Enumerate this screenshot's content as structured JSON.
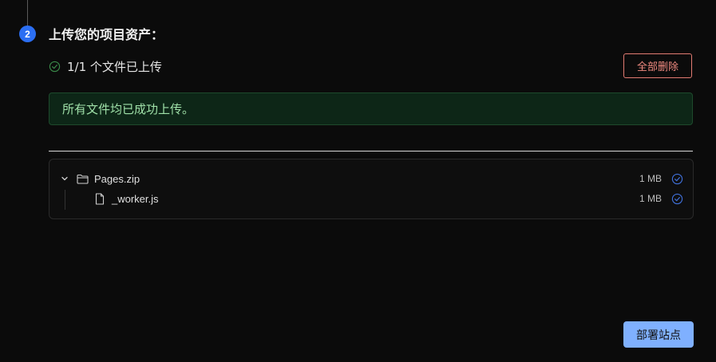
{
  "step": {
    "number": "2",
    "title": "上传您的项目资产："
  },
  "status": {
    "text": "1/1 个文件已上传"
  },
  "actions": {
    "delete_all_label": "全部删除",
    "deploy_label": "部署站点"
  },
  "banner": {
    "text": "所有文件均已成功上传。"
  },
  "files": [
    {
      "name": "Pages.zip",
      "size": "1 MB",
      "type": "folder",
      "expanded": true
    },
    {
      "name": "_worker.js",
      "size": "1 MB",
      "type": "file"
    }
  ],
  "colors": {
    "accent": "#2b6ef2",
    "danger": "#e27b72",
    "success_bg": "#0d2617",
    "success_text": "#9fe0a8",
    "primary_button": "#7fb0ff"
  },
  "icons": {
    "status": "check-circle-icon",
    "folder": "folder-icon",
    "file": "file-icon",
    "expand": "chevron-down-icon",
    "uploaded": "check-circle-icon"
  }
}
